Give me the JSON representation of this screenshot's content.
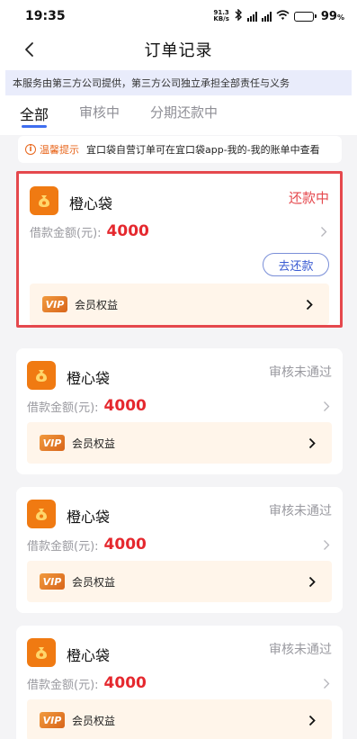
{
  "status_bar": {
    "time": "19:35",
    "net_speed_value": "91.3",
    "net_speed_unit": "KB/s",
    "battery": "99",
    "battery_unit": "%"
  },
  "nav": {
    "title": "订单记录"
  },
  "notice": "本服务由第三方公司提供，第三方公司独立承担全部责任与义务",
  "tabs": [
    {
      "label": "全部"
    },
    {
      "label": "审核中"
    },
    {
      "label": "分期还款中"
    }
  ],
  "tip": {
    "label": "温馨提示",
    "text": "宜口袋自营订单可在宜口袋app-我的-我的账单中查看"
  },
  "orders": [
    {
      "name": "橙心袋",
      "status": "还款中",
      "amount_label": "借款金额(元):",
      "amount": "4000",
      "repay_label": "去还款",
      "vip_badge": "VIP",
      "vip_label": "会员权益"
    },
    {
      "name": "橙心袋",
      "status": "审核未通过",
      "amount_label": "借款金额(元):",
      "amount": "4000",
      "vip_badge": "VIP",
      "vip_label": "会员权益"
    },
    {
      "name": "橙心袋",
      "status": "审核未通过",
      "amount_label": "借款金额(元):",
      "amount": "4000",
      "vip_badge": "VIP",
      "vip_label": "会员权益"
    },
    {
      "name": "橙心袋",
      "status": "审核未通过",
      "amount_label": "借款金额(元):",
      "amount": "4000",
      "vip_badge": "VIP",
      "vip_label": "会员权益"
    }
  ],
  "colors": {
    "accent": "#3f6ef0",
    "amount": "#e5282e",
    "status_repaying": "#e5484d",
    "status_rejected": "#9a9aa0",
    "logo": "#f07a12",
    "vip_bg": "#fff5ea",
    "highlight_border": "#e5484d"
  }
}
